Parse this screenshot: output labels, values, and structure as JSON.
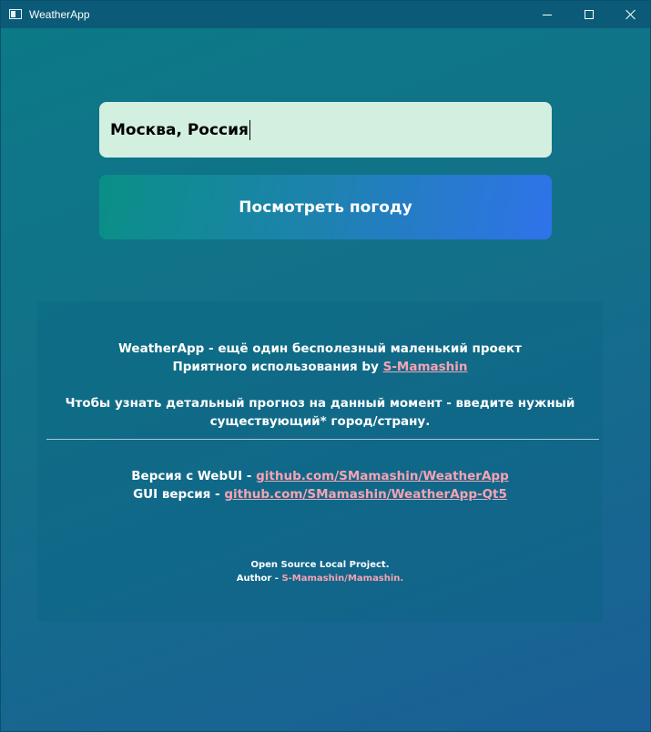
{
  "window": {
    "title": "WeatherApp"
  },
  "search": {
    "value": "Москва, Россия"
  },
  "submit": {
    "label": "Посмотреть погоду"
  },
  "info": {
    "line1": "WeatherApp - ещё один бесполезный маленький проект",
    "line2_prefix": "Приятного использования by ",
    "line2_link": "S-Mamashin",
    "line3": "Чтобы узнать детальный прогноз на данный момент - введите нужный",
    "line4": "существующий* город/страну.",
    "webui_prefix": "Версия с WebUI - ",
    "webui_link": "github.com/SMamashin/WeatherApp",
    "gui_prefix": "GUI версия - ",
    "gui_link": "github.com/SMamashin/WeatherApp-Qt5"
  },
  "footer": {
    "line1": "Open Source Local Project.",
    "author_prefix": "Author - ",
    "author_name": "S-Mamashin/Mamashin."
  }
}
